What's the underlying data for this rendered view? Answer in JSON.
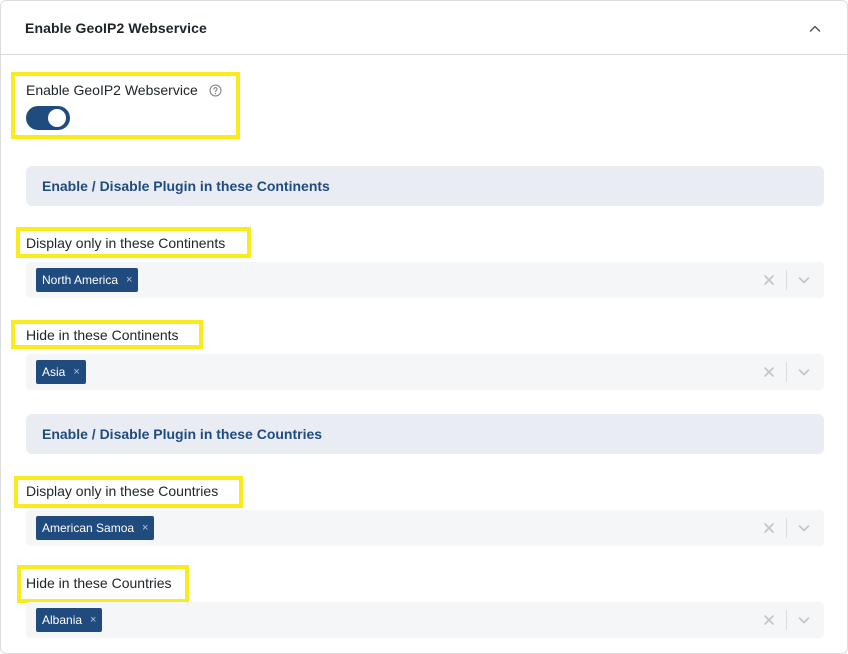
{
  "panel": {
    "title": "Enable GeoIP2 Webservice"
  },
  "geoip": {
    "label": "Enable GeoIP2 Webservice",
    "toggle_on": true
  },
  "continents_section": {
    "title": "Enable / Disable Plugin in these Continents",
    "display_label": "Display only in these Continents",
    "display_tags": [
      "North America"
    ],
    "hide_label": "Hide in these Continents",
    "hide_tags": [
      "Asia"
    ]
  },
  "countries_section": {
    "title": "Enable / Disable Plugin in these Countries",
    "display_label": "Display only in these Countries",
    "display_tags": [
      "American Samoa"
    ],
    "hide_label": "Hide in these Countries",
    "hide_tags": [
      "Albania"
    ]
  },
  "tag_remove_glyph": "×",
  "colors": {
    "accent": "#1f4b7f",
    "highlight": "#f8ec1c",
    "section_bg": "#e9edf3",
    "select_bg": "#f5f6f8"
  },
  "icons": [
    "chevron-up-icon",
    "help-circle-icon",
    "close-icon",
    "chevron-down-icon"
  ]
}
